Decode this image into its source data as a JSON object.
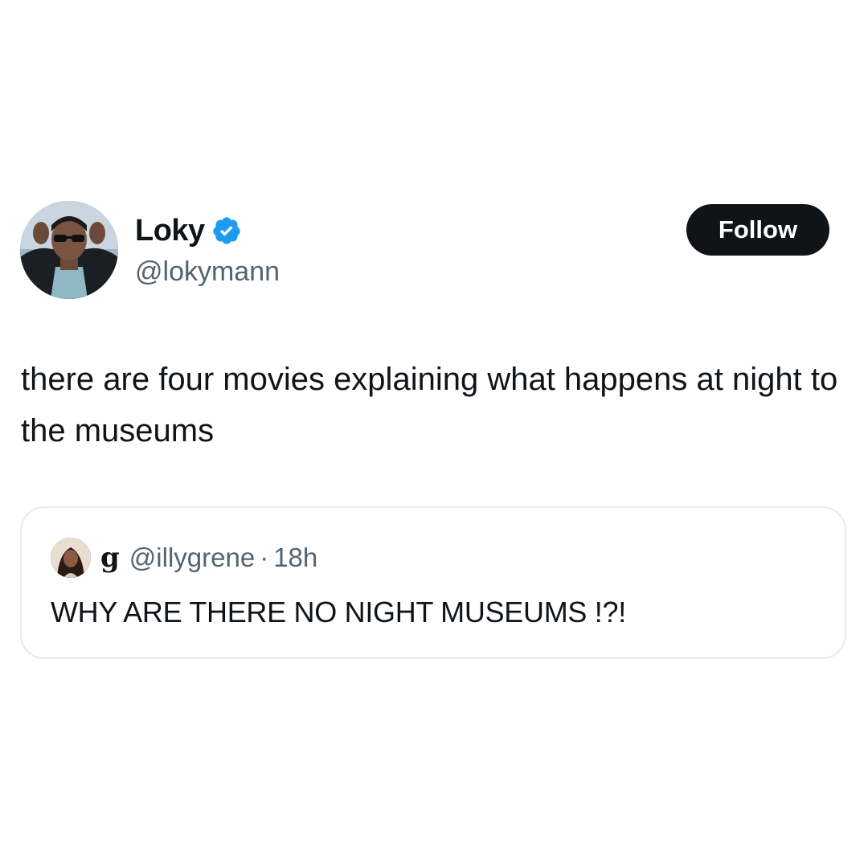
{
  "tweet": {
    "author": {
      "display_name": "Loky",
      "handle": "@lokymann",
      "verified": true,
      "verified_color": "#1d9bf0"
    },
    "follow_label": "Follow",
    "text": "there are four movies explaining what happens at night to the museums"
  },
  "quoted_tweet": {
    "author": {
      "display_name": "g",
      "handle": "@illygrene"
    },
    "separator": "·",
    "time": "18h",
    "text": "WHY ARE THERE NO NIGHT MUSEUMS !?!"
  },
  "icons": {
    "verified": "verified-badge-icon"
  },
  "colors": {
    "text_primary": "#0f1419",
    "text_secondary": "#536471",
    "follow_bg": "#0f1419",
    "card_border": "#e6ebee"
  }
}
